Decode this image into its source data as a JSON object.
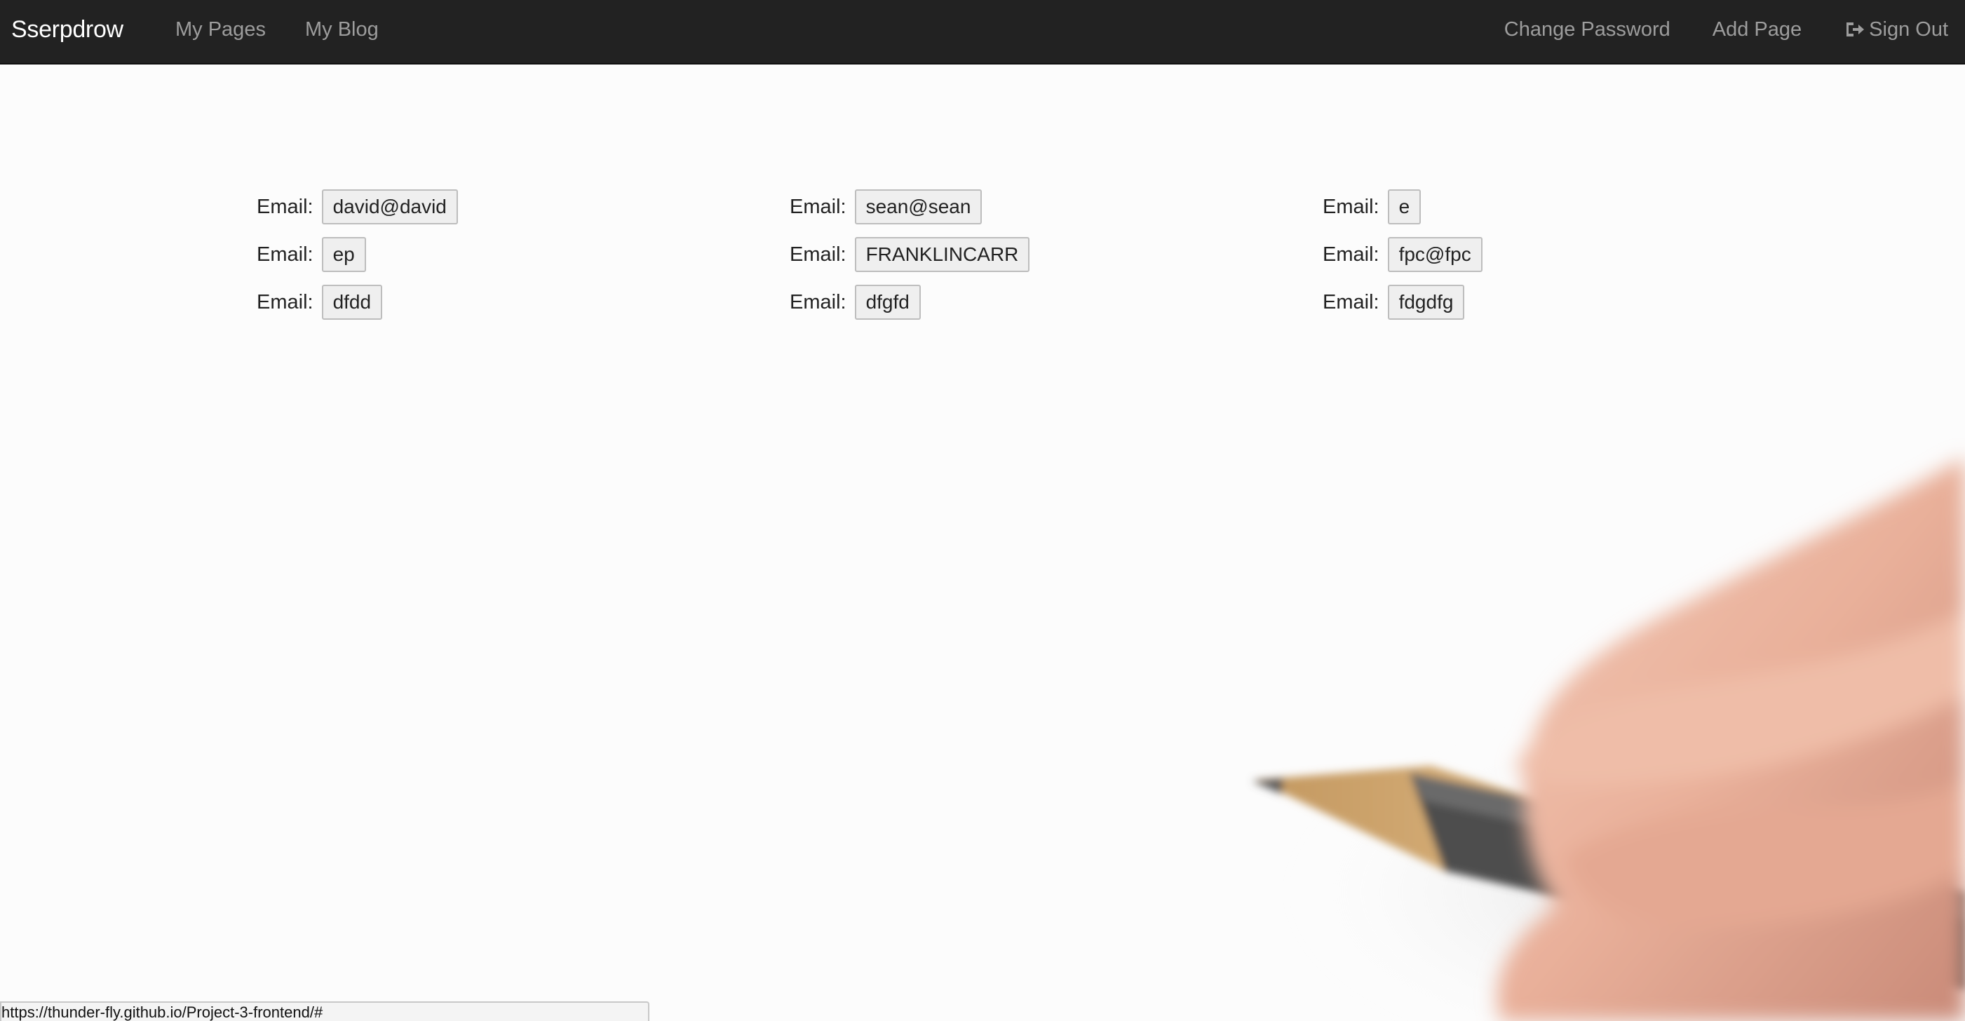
{
  "navbar": {
    "brand": "Sserpdrow",
    "left_links": [
      "My Pages",
      "My Blog"
    ],
    "right_links": {
      "change_password": "Change Password",
      "add_page": "Add Page",
      "sign_out": "Sign Out"
    },
    "sign_out_icon": "log-out-icon"
  },
  "emails": {
    "label": "Email:",
    "columns": [
      [
        "david@david",
        "ep",
        "dfdd"
      ],
      [
        "sean@sean",
        "FRANKLINCARR",
        "dfgfd"
      ],
      [
        "e",
        "fpc@fpc",
        "fdgdfg"
      ]
    ]
  },
  "status_bar": {
    "url": "https://thunder-fly.github.io/Project-3-frontend/#"
  },
  "colors": {
    "navbar_bg": "#222222",
    "brand": "#ffffff",
    "nav_link": "#9d9d9d",
    "page_bg": "#fcfcfc"
  }
}
